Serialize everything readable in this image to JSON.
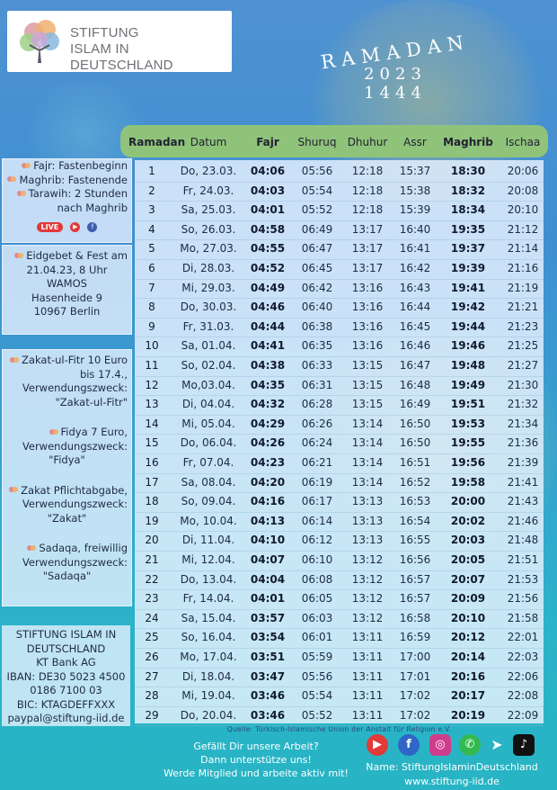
{
  "logo": {
    "line1": "STIFTUNG",
    "line2": "ISLAM IN DEUTSCHLAND"
  },
  "title": {
    "word": "RAMADAN",
    "year_gregorian": "2023",
    "year_hijri": "1444"
  },
  "table": {
    "headers": [
      "Ramadan",
      "Datum",
      "Fajr",
      "Shuruq",
      "Dhuhur",
      "Assr",
      "Maghrib",
      "Ischaa"
    ],
    "bold_headers": [
      "Ramadan",
      "Fajr",
      "Maghrib"
    ],
    "rows": [
      [
        "1",
        "Do, 23.03.",
        "04:06",
        "05:56",
        "12:18",
        "15:37",
        "18:30",
        "20:06"
      ],
      [
        "2",
        "Fr, 24.03.",
        "04:03",
        "05:54",
        "12:18",
        "15:38",
        "18:32",
        "20:08"
      ],
      [
        "3",
        "Sa, 25.03.",
        "04:01",
        "05:52",
        "12:18",
        "15:39",
        "18:34",
        "20:10"
      ],
      [
        "4",
        "So, 26.03.",
        "04:58",
        "06:49",
        "13:17",
        "16:40",
        "19:35",
        "21:12"
      ],
      [
        "5",
        "Mo, 27.03.",
        "04:55",
        "06:47",
        "13:17",
        "16:41",
        "19:37",
        "21:14"
      ],
      [
        "6",
        "Di, 28.03.",
        "04:52",
        "06:45",
        "13:17",
        "16:42",
        "19:39",
        "21:16"
      ],
      [
        "7",
        "Mi, 29.03.",
        "04:49",
        "06:42",
        "13:16",
        "16:43",
        "19:41",
        "21:19"
      ],
      [
        "8",
        "Do, 30.03.",
        "04:46",
        "06:40",
        "13:16",
        "16:44",
        "19:42",
        "21:21"
      ],
      [
        "9",
        "Fr, 31.03.",
        "04:44",
        "06:38",
        "13:16",
        "16:45",
        "19:44",
        "21:23"
      ],
      [
        "10",
        "Sa, 01.04.",
        "04:41",
        "06:35",
        "13:16",
        "16:46",
        "19:46",
        "21:25"
      ],
      [
        "11",
        "So, 02.04.",
        "04:38",
        "06:33",
        "13:15",
        "16:47",
        "19:48",
        "21:27"
      ],
      [
        "12",
        "Mo,03.04.",
        "04:35",
        "06:31",
        "13:15",
        "16:48",
        "19:49",
        "21:30"
      ],
      [
        "13",
        "Di, 04.04.",
        "04:32",
        "06:28",
        "13:15",
        "16:49",
        "19:51",
        "21:32"
      ],
      [
        "14",
        "Mi, 05.04.",
        "04:29",
        "06:26",
        "13:14",
        "16:50",
        "19:53",
        "21:34"
      ],
      [
        "15",
        "Do, 06.04.",
        "04:26",
        "06:24",
        "13:14",
        "16:50",
        "19:55",
        "21:36"
      ],
      [
        "16",
        "Fr, 07.04.",
        "04:23",
        "06:21",
        "13:14",
        "16:51",
        "19:56",
        "21:39"
      ],
      [
        "17",
        "Sa, 08.04.",
        "04:20",
        "06:19",
        "13:14",
        "16:52",
        "19:58",
        "21:41"
      ],
      [
        "18",
        "So, 09.04.",
        "04:16",
        "06:17",
        "13:13",
        "16:53",
        "20:00",
        "21:43"
      ],
      [
        "19",
        "Mo, 10.04.",
        "04:13",
        "06:14",
        "13:13",
        "16:54",
        "20:02",
        "21:46"
      ],
      [
        "20",
        "Di, 11.04.",
        "04:10",
        "06:12",
        "13:13",
        "16:55",
        "20:03",
        "21:48"
      ],
      [
        "21",
        "Mi, 12.04.",
        "04:07",
        "06:10",
        "13:12",
        "16:56",
        "20:05",
        "21:51"
      ],
      [
        "22",
        "Do, 13.04.",
        "04:04",
        "06:08",
        "13:12",
        "16:57",
        "20:07",
        "21:53"
      ],
      [
        "23",
        "Fr, 14.04.",
        "04:01",
        "06:05",
        "13:12",
        "16:57",
        "20:09",
        "21:56"
      ],
      [
        "24",
        "Sa, 15.04.",
        "03:57",
        "06:03",
        "13:12",
        "16:58",
        "20:10",
        "21:58"
      ],
      [
        "25",
        "So, 16.04.",
        "03:54",
        "06:01",
        "13:11",
        "16:59",
        "20:12",
        "22:01"
      ],
      [
        "26",
        "Mo, 17.04.",
        "03:51",
        "05:59",
        "13:11",
        "17:00",
        "20:14",
        "22:03"
      ],
      [
        "27",
        "Di, 18.04.",
        "03:47",
        "05:56",
        "13:11",
        "17:01",
        "20:16",
        "22:06"
      ],
      [
        "28",
        "Mi, 19.04.",
        "03:46",
        "05:54",
        "13:11",
        "17:02",
        "20:17",
        "22:08"
      ],
      [
        "29",
        "Do, 20.04.",
        "03:46",
        "05:52",
        "13:11",
        "17:02",
        "20:19",
        "22:09"
      ]
    ]
  },
  "sidebar": {
    "legend": {
      "line1": "Fajr: Fastenbeginn",
      "line2": "Maghrib: Fastenende",
      "line3": "Tarawih: 2 Stunden",
      "line4": "nach Maghrib",
      "live_label": "LIVE"
    },
    "eid": {
      "line1": "Eidgebet & Fest am",
      "line2": "21.04.23, 8 Uhr",
      "line3": "WAMOS",
      "line4": "Hasenheide 9",
      "line5": "10967 Berlin"
    },
    "zakat_fitr": {
      "line1": "Zakat-ul-Fitr 10 Euro",
      "line2": "bis 17.4.,",
      "line3": "Verwendungszweck:",
      "line4": "\"Zakat-ul-Fitr\""
    },
    "fidya": {
      "line1": "Fidya 7 Euro,",
      "line2": "Verwendungszweck:",
      "line3": "\"Fidya\""
    },
    "zakat": {
      "line1": "Zakat Pflichtabgabe,",
      "line2": "Verwendungszweck:",
      "line3": "\"Zakat\""
    },
    "sadaqa": {
      "line1": "Sadaqa, freiwillig",
      "line2": "Verwendungszweck:",
      "line3": "\"Sadaqa\""
    },
    "bank": {
      "line1": "STIFTUNG ISLAM IN",
      "line2": "DEUTSCHLAND",
      "line3": "KT Bank AG",
      "line4": "IBAN: DE30 5023 4500",
      "line5": "0186 7100 03",
      "line6": "BIC: KTAGDEFFXXX",
      "line7": "paypal@stiftung-iid.de"
    }
  },
  "footer": {
    "source": "Quelle: Türkisch-Islamische Union der Anstalt für Religion e.V.",
    "support_line1": "Gefällt Dir unsere Arbeit?",
    "support_line2": "Dann unterstütze uns!",
    "support_line3": "Werde Mitglied und arbeite aktiv mit!",
    "social_name": "Name: StiftungIslaminDeutschland",
    "website": "www.stiftung-iid.de",
    "social_icons": [
      "youtube-icon",
      "facebook-icon",
      "instagram-icon",
      "whatsapp-icon",
      "telegram-icon",
      "tiktok-icon"
    ]
  },
  "colors": {
    "header_bar": "#8fc37a",
    "table_bg": "#e9f3ff",
    "live_red": "#e23939"
  }
}
